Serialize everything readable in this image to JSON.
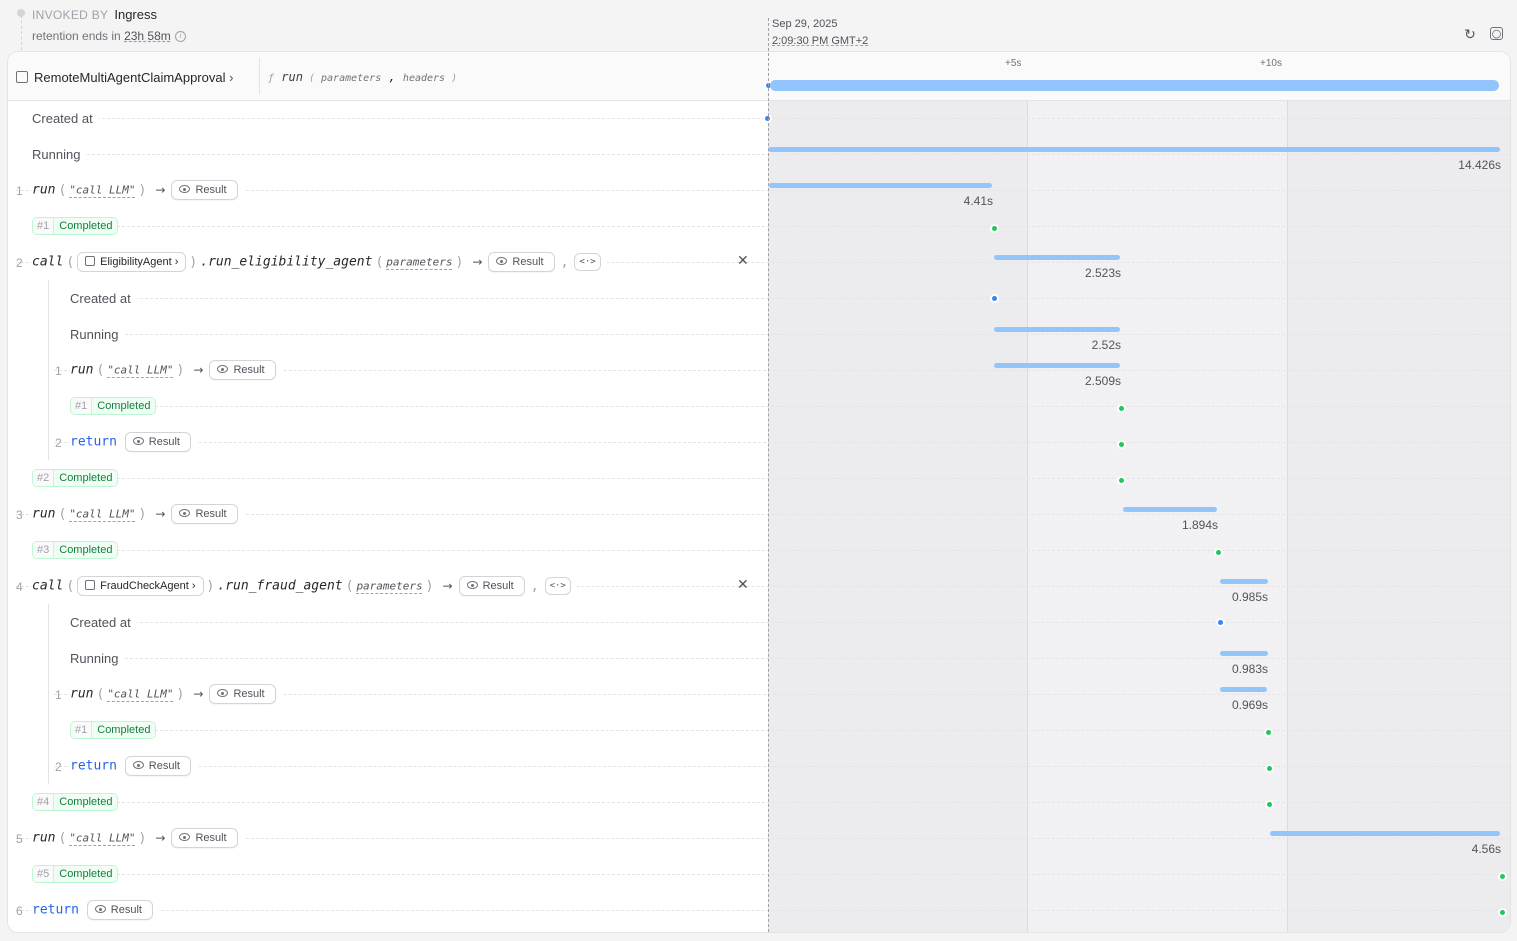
{
  "invoked": {
    "label": "INVOKED BY",
    "value": "Ingress"
  },
  "retention": {
    "prefix": "retention ends in",
    "value": "23h 58m",
    "info_icon": "info-icon"
  },
  "timeline": {
    "date": "Sep 29, 2025",
    "time": "2:09:30 PM GMT+2",
    "ticks": [
      "+5s",
      "+10s"
    ]
  },
  "toolbar": {
    "refresh_icon": "refresh-icon",
    "zoom_icon": "zoom-icon"
  },
  "header": {
    "service": "RemoteMultiAgentClaimApproval",
    "handler": "run",
    "params": [
      "parameters",
      "headers"
    ]
  },
  "rows": {
    "created_at": "Created at",
    "running": "Running",
    "running_duration": "14.426s",
    "step1": {
      "num": "1",
      "fn": "run",
      "arg": "\"call LLM\"",
      "result": "Result",
      "duration": "4.41s",
      "badge_n": "#1",
      "badge_s": "Completed"
    },
    "step2": {
      "num": "2",
      "fn": "call",
      "agent": "EligibilityAgent",
      "method": ".run_eligibility_agent",
      "arg": "parameters",
      "result": "Result",
      "duration": "2.523s",
      "created_at": "Created at",
      "running": "Running",
      "running_duration": "2.52s",
      "sub1": {
        "num": "1",
        "fn": "run",
        "arg": "\"call LLM\"",
        "result": "Result",
        "duration": "2.509s",
        "badge_n": "#1",
        "badge_s": "Completed"
      },
      "sub2": {
        "num": "2",
        "fn": "return",
        "result": "Result"
      },
      "badge_n": "#2",
      "badge_s": "Completed"
    },
    "step3": {
      "num": "3",
      "fn": "run",
      "arg": "\"call LLM\"",
      "result": "Result",
      "duration": "1.894s",
      "badge_n": "#3",
      "badge_s": "Completed"
    },
    "step4": {
      "num": "4",
      "fn": "call",
      "agent": "FraudCheckAgent",
      "method": ".run_fraud_agent",
      "arg": "parameters",
      "result": "Result",
      "duration": "0.985s",
      "created_at": "Created at",
      "running": "Running",
      "running_duration": "0.983s",
      "sub1": {
        "num": "1",
        "fn": "run",
        "arg": "\"call LLM\"",
        "result": "Result",
        "duration": "0.969s",
        "badge_n": "#1",
        "badge_s": "Completed"
      },
      "sub2": {
        "num": "2",
        "fn": "return",
        "result": "Result"
      },
      "badge_n": "#4",
      "badge_s": "Completed"
    },
    "step5": {
      "num": "5",
      "fn": "run",
      "arg": "\"call LLM\"",
      "result": "Result",
      "duration": "4.56s",
      "badge_n": "#5",
      "badge_s": "Completed"
    },
    "step6": {
      "num": "6",
      "fn": "return",
      "result": "Result"
    }
  }
}
